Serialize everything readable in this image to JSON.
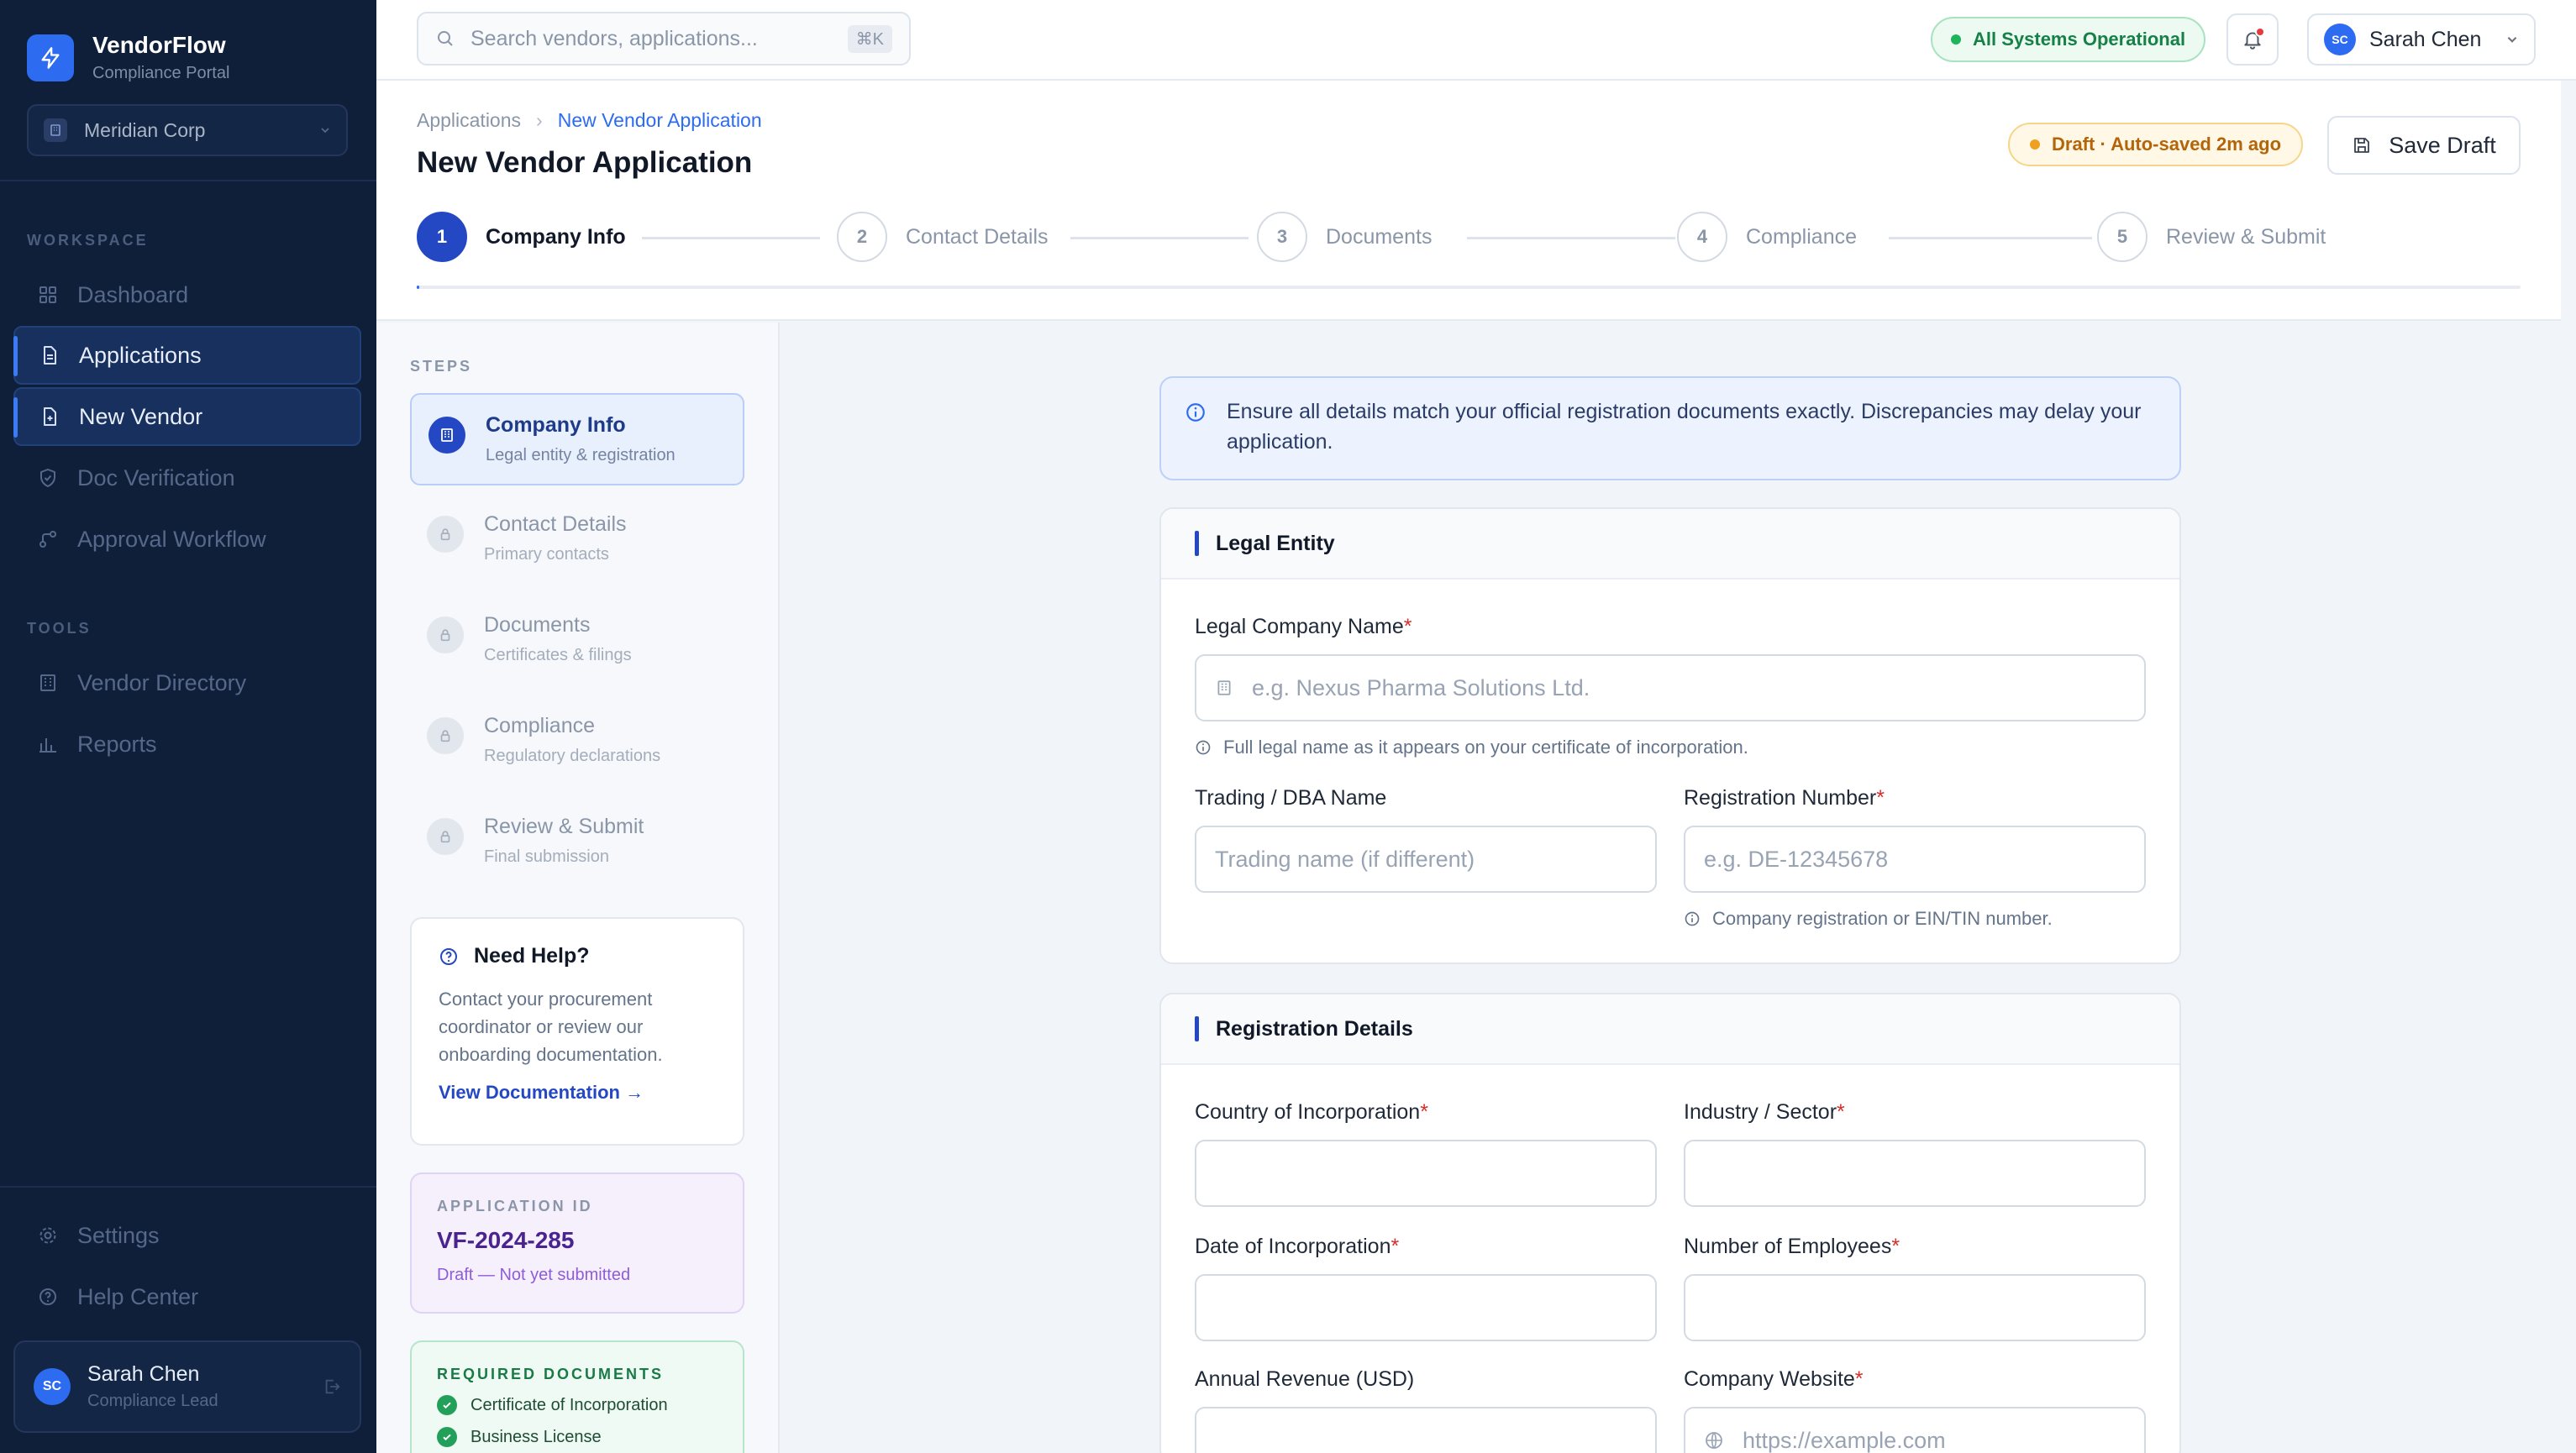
{
  "app": {
    "name": "VendorFlow",
    "subtitle": "Compliance Portal",
    "org": "Meridian Corp"
  },
  "sidebar": {
    "workspace_label": "WORKSPACE",
    "tools_label": "TOOLS",
    "workspace_items": [
      {
        "label": "Dashboard",
        "icon": "grid-icon",
        "active": false
      },
      {
        "label": "Applications",
        "icon": "document-icon",
        "active": true
      },
      {
        "label": "New Vendor",
        "icon": "document-plus-icon",
        "active": true
      },
      {
        "label": "Doc Verification",
        "icon": "shield-check-icon",
        "active": false
      },
      {
        "label": "Approval Workflow",
        "icon": "workflow-icon",
        "active": false
      }
    ],
    "tools_items": [
      {
        "label": "Vendor Directory",
        "icon": "building-icon"
      },
      {
        "label": "Reports",
        "icon": "bar-chart-icon"
      }
    ],
    "bottom_items": [
      {
        "label": "Settings",
        "icon": "gear-icon"
      },
      {
        "label": "Help Center",
        "icon": "help-circle-icon"
      }
    ],
    "user": {
      "initials": "SC",
      "name": "Sarah Chen",
      "role": "Compliance Lead"
    }
  },
  "topbar": {
    "search_placeholder": "Search vendors, applications...",
    "search_shortcut": "⌘K",
    "status": "All Systems Operational",
    "user": {
      "initials": "SC",
      "name": "Sarah Chen"
    }
  },
  "header": {
    "breadcrumb": [
      "Applications",
      "New Vendor Application"
    ],
    "title": "New Vendor Application",
    "draft_status": "Draft · Auto-saved 2m ago",
    "save_label": "Save Draft",
    "steps": [
      {
        "num": "1",
        "label": "Company Info",
        "active": true
      },
      {
        "num": "2",
        "label": "Contact Details",
        "active": false
      },
      {
        "num": "3",
        "label": "Documents",
        "active": false
      },
      {
        "num": "4",
        "label": "Compliance",
        "active": false
      },
      {
        "num": "5",
        "label": "Review & Submit",
        "active": false
      }
    ],
    "progress_fraction": 0.0
  },
  "steps_panel": {
    "label": "STEPS",
    "items": [
      {
        "title": "Company Info",
        "sub": "Legal entity & registration",
        "active": true
      },
      {
        "title": "Contact Details",
        "sub": "Primary contacts",
        "active": false
      },
      {
        "title": "Documents",
        "sub": "Certificates & filings",
        "active": false
      },
      {
        "title": "Compliance",
        "sub": "Regulatory declarations",
        "active": false
      },
      {
        "title": "Review & Submit",
        "sub": "Final submission",
        "active": false
      }
    ],
    "help": {
      "title": "Need Help?",
      "body": "Contact your procurement coordinator or review our onboarding documentation.",
      "link": "View Documentation →"
    },
    "application": {
      "label": "APPLICATION ID",
      "id": "VF-2024-285",
      "status": "Draft — Not yet submitted"
    },
    "required_docs": {
      "label": "REQUIRED DOCUMENTS",
      "items": [
        "Certificate of Incorporation",
        "Business License"
      ]
    }
  },
  "form": {
    "notice": "Ensure all details match your official registration documents exactly. Discrepancies may delay your application.",
    "legal_entity": {
      "title": "Legal Entity",
      "legal_name": {
        "label": "Legal Company Name",
        "placeholder": "e.g. Nexus Pharma Solutions Ltd.",
        "hint": "Full legal name as it appears on your certificate of incorporation."
      },
      "trading_name": {
        "label": "Trading / DBA Name",
        "placeholder": "Trading name (if different)"
      },
      "registration_number": {
        "label": "Registration Number",
        "placeholder": "e.g. DE-12345678",
        "hint": "Company registration or EIN/TIN number."
      }
    },
    "registration": {
      "title": "Registration Details",
      "country": {
        "label": "Country of Incorporation",
        "value": ""
      },
      "industry": {
        "label": "Industry / Sector",
        "value": ""
      },
      "date": {
        "label": "Date of Incorporation",
        "value": ""
      },
      "employees": {
        "label": "Number of Employees",
        "value": ""
      },
      "revenue": {
        "label": "Annual Revenue (USD)",
        "value": ""
      },
      "website": {
        "label": "Company Website",
        "placeholder": "https://example.com"
      }
    }
  },
  "colors": {
    "sidebar_bg": "#0f1f3a",
    "accent": "#2447c4",
    "success": "#1fb35c",
    "warning": "#f0a020"
  }
}
